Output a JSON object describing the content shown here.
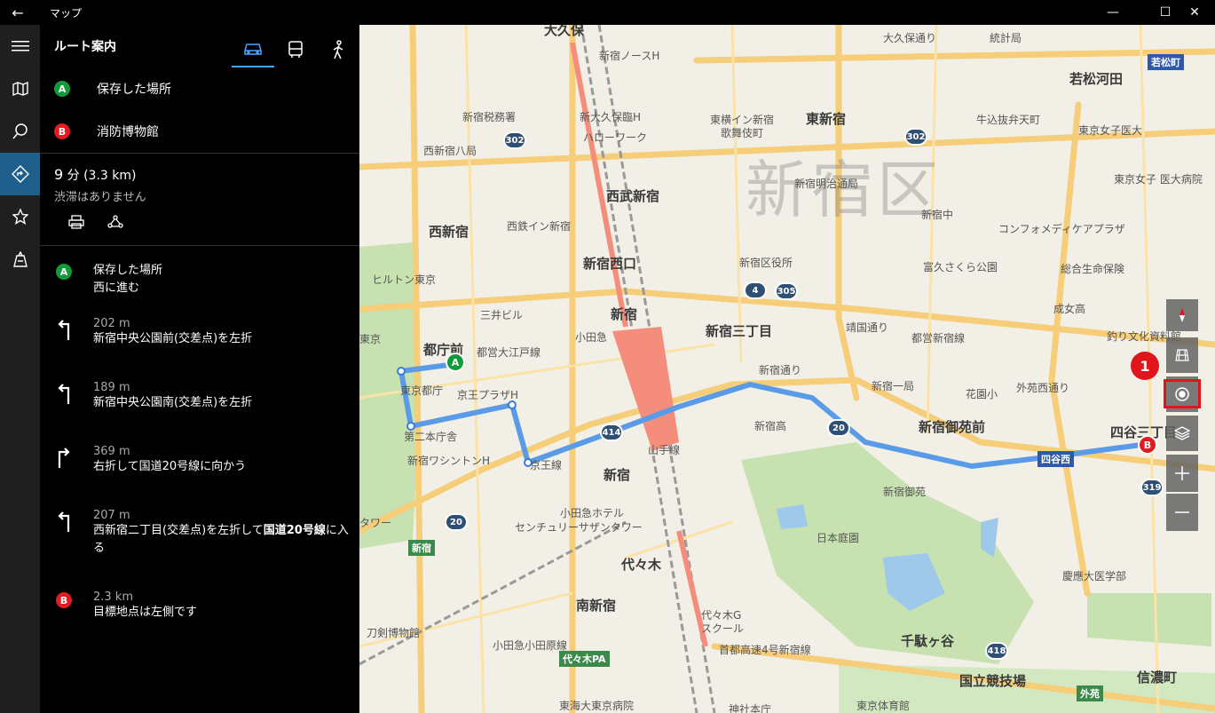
{
  "window": {
    "title": "マップ"
  },
  "panel": {
    "title": "ルート案内",
    "waypoint_a": {
      "marker": "A",
      "label": "保存した場所"
    },
    "waypoint_b": {
      "marker": "B",
      "label": "消防博物館"
    },
    "summary": {
      "minutes": "9",
      "unit": "分",
      "distance": "(3.3 km)",
      "traffic": "渋滞はありません"
    },
    "steps": [
      {
        "marker": "A",
        "title": "保存した場所",
        "text": "西に進む"
      },
      {
        "dist": "202 m",
        "text": "新宿中央公園前(交差点)を左折"
      },
      {
        "dist": "189 m",
        "text": "新宿中央公園南(交差点)を左折"
      },
      {
        "dist": "369 m",
        "text": "右折して国道20号線に向かう"
      },
      {
        "dist": "207 m",
        "text_pre": "西新宿二丁目(交差点)を左折して",
        "text_bold": "国道20号線",
        "text_post": "に入る"
      },
      {
        "marker": "B",
        "dist": "2.3 km",
        "text": "目標地点は左側です"
      }
    ]
  },
  "map": {
    "district": "新宿区",
    "labels": {
      "l1": "大久保",
      "l2": "新宿ノースH",
      "l3": "大久保通り",
      "l4": "統計局",
      "l5": "若松河田",
      "l6": "若松町",
      "l7": "新宿税務署",
      "l8": "新大久保臨H",
      "l9": "ハローワーク",
      "l10": "東横イン新宿",
      "l11": "歌舞伎町",
      "l12": "東新宿",
      "l13": "牛込抜弁天町",
      "l14": "東京女子医大",
      "l15": "西新宿八局",
      "l16": "西武新宿",
      "l17": "新宿明治通局",
      "l18": "東京女子\n医大病院",
      "l19": "西新宿",
      "l20": "西鉄イン新宿",
      "l21": "新宿中",
      "l22": "コンフォメディケアプラザ",
      "l23": "新宿西口",
      "l24": "新宿区役所",
      "l25": "富久さくら公園",
      "l26": "総合生命保険",
      "l27": "ヒルトン東京",
      "l28": "三井ビル",
      "l29": "新宿",
      "l30": "小田急",
      "l31": "新宿三丁目",
      "l32": "成女高",
      "l33": "靖国通り",
      "l34": "都営新宿線",
      "l35": "釣り文化資料館",
      "l36": "都庁前",
      "l37": "都営大江戸線",
      "l38": "東京都庁",
      "l39": "京王プラザH",
      "l40": "新宿通り",
      "l41": "新宿一局",
      "l42": "花園小",
      "l43": "外苑西通り",
      "l44": "第二本庁舎",
      "l45": "新宿ワシントンH",
      "l46": "京王線",
      "l47": "山手線",
      "l48": "新宿高",
      "l49": "新宿御苑前",
      "l50": "四谷三丁目",
      "l51": "新宿",
      "l52": "新宿御苑",
      "l53": "小田急ホテル",
      "l54": "センチュリーサザンタワー",
      "l55": "日本庭園",
      "l56": "代々木",
      "l57": "慶應大医学部",
      "l58": "南新宿",
      "l59": "代々木G",
      "l60": "スクール",
      "l61": "千駄ヶ谷",
      "l62": "刀剣博物館",
      "l63": "小田急小田原線",
      "l64": "首都高速4号新宿線",
      "l65": "国立競技場",
      "l66": "信濃町",
      "l67": "東海大東京病院",
      "l68": "神社本庁",
      "l69": "東京体育館",
      "l70": "タワー",
      "l71": "東京都庁",
      "l72": "東京"
    },
    "shields": [
      "302",
      "302",
      "4",
      "305",
      "414",
      "20",
      "20",
      "319",
      "418"
    ],
    "green_signs": [
      "新宿",
      "代々木PA",
      "外苑"
    ],
    "blue_signs": [
      "若松町",
      "四谷西"
    ]
  },
  "annotation": {
    "badge": "1"
  }
}
